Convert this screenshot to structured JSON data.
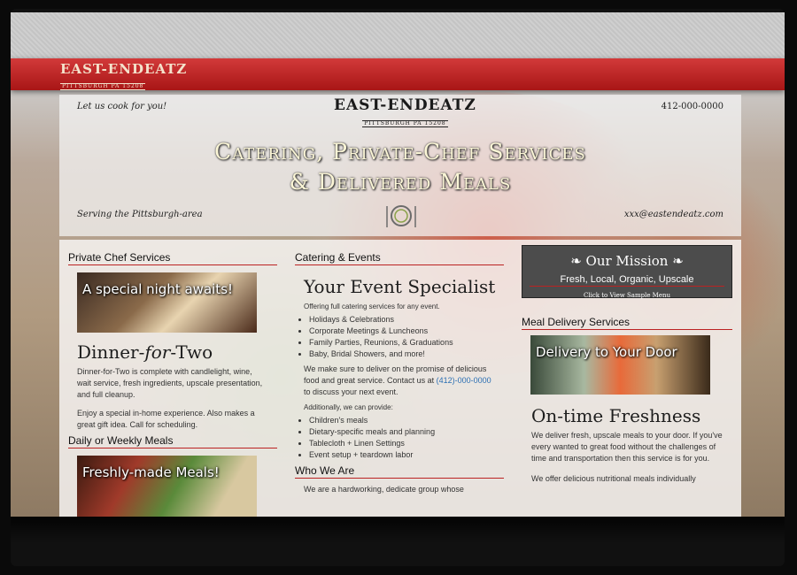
{
  "brand": {
    "name_line1": "EAST-ENDEATZ",
    "name_line2": "PITTSBURGH PA 15208"
  },
  "hero": {
    "tagline": "Let us cook for you!",
    "phone": "412-000-0000",
    "headline_line1": "Catering, Private-Chef Services",
    "headline_line2": "& Delivered Meals",
    "serving": "Serving the Pittsburgh-area",
    "email": "xxx@eastendeatz.com"
  },
  "col1": {
    "header": "Private Chef Services",
    "photo_caption": "A special night awaits!",
    "title_a": "Dinner-",
    "title_b": "for",
    "title_c": "-Two",
    "para1": "Dinner-for-Two is complete with candlelight, wine, wait service, fresh ingredients, upscale presentation, and full cleanup.",
    "para2": "Enjoy a special in-home experience. Also makes a great gift idea. Call for scheduling.",
    "header2": "Daily or Weekly Meals",
    "photo2_caption": "Freshly-made Meals!"
  },
  "col2": {
    "header": "Catering & Events",
    "title": "Your Event Specialist",
    "intro": "Offering full catering services for any event.",
    "events": [
      "Holidays & Celebrations",
      "Corporate Meetings & Luncheons",
      "Family Parties, Reunions, & Graduations",
      "Baby, Bridal Showers, and more!"
    ],
    "para_a": "We make sure to deliver on the promise of delicious food and great service. Contact us at ",
    "phone_link": "(412)-000-0000",
    "para_b": " to discuss your next event.",
    "additionally": "Additionally, we can provide:",
    "services": [
      "Children's meals",
      "Dietary-specific meals and planning",
      "Tablecloth + Linen Settings",
      "Event setup + teardown labor"
    ],
    "header2": "Who We Are",
    "who_text": "We are a hardworking, dedicate group whose"
  },
  "col3": {
    "mission_title": "❧ Our Mission ❧",
    "mission_sub": "Fresh, Local, Organic, Upscale",
    "mission_link": "Click to View Sample Menu",
    "header": "Meal Delivery Services",
    "photo_caption": "Delivery to Your Door",
    "title": "On-time Freshness",
    "para1": "We deliver fresh, upscale meals to your door. If you've every wanted to great food without the challenges of time and transportation then this service is for you.",
    "para2": "We offer delicious nutritional meals individually"
  },
  "colors": {
    "accent_red": "#b22222",
    "link_blue": "#2b6fb3",
    "mission_bg": "#4c4c4c"
  }
}
